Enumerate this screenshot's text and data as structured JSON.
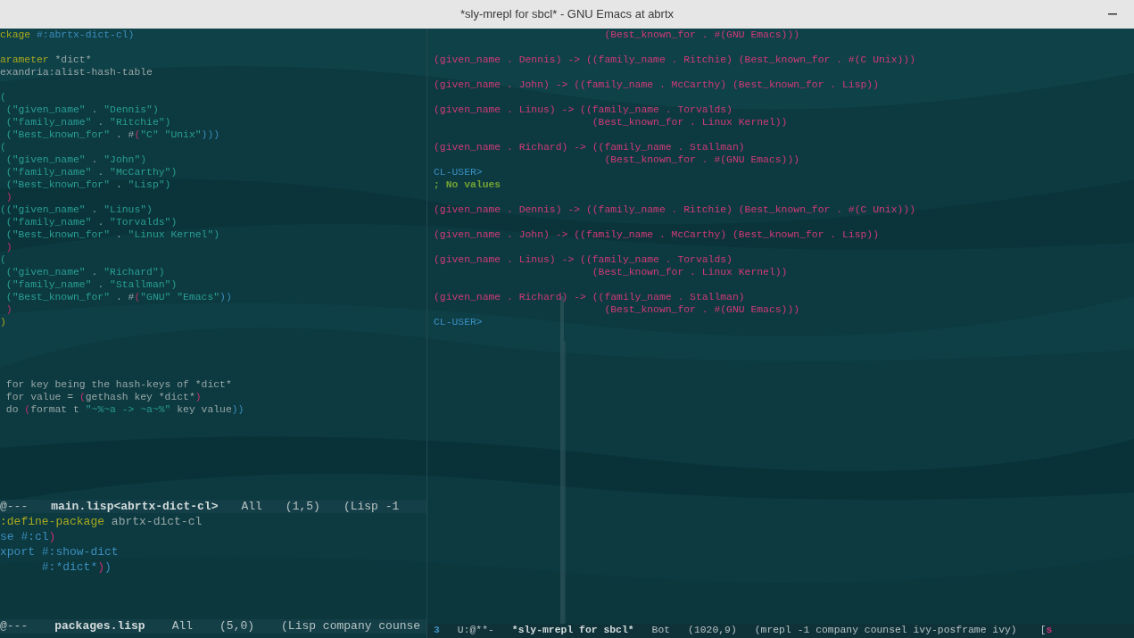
{
  "window": {
    "title": "*sly-mrepl for sbcl* - GNU Emacs at abrtx"
  },
  "left_top_buffer": {
    "lines": [
      {
        "kind": "code",
        "segments": [
          {
            "text": "ckage",
            "kind": "kw"
          },
          {
            "text": " #:abrtx-dict-cl",
            "kind": "sym"
          },
          {
            "text": ")",
            "kind": "pb"
          }
        ]
      },
      {
        "kind": "blank"
      },
      {
        "kind": "code",
        "segments": [
          {
            "text": "arameter",
            "kind": "kw"
          },
          {
            "text": " *dict*",
            "kind": "plain"
          }
        ]
      },
      {
        "kind": "code",
        "segments": [
          {
            "text": "exandria:alist-hash-table",
            "kind": "plain"
          }
        ]
      },
      {
        "kind": "blank"
      },
      {
        "kind": "code",
        "segments": [
          {
            "text": "(",
            "kind": "str"
          }
        ]
      },
      {
        "kind": "code",
        "segments": [
          {
            "text": " (\"given_name\"",
            "kind": "str"
          },
          {
            "text": " . ",
            "kind": "plain"
          },
          {
            "text": "\"Dennis\")",
            "kind": "str"
          }
        ]
      },
      {
        "kind": "code",
        "segments": [
          {
            "text": " (\"family_name\"",
            "kind": "str"
          },
          {
            "text": " . ",
            "kind": "plain"
          },
          {
            "text": "\"Ritchie\")",
            "kind": "str"
          }
        ]
      },
      {
        "kind": "code",
        "segments": [
          {
            "text": " (\"Best_known_for\"",
            "kind": "str"
          },
          {
            "text": " . #",
            "kind": "plain"
          },
          {
            "text": "(",
            "kind": "pm"
          },
          {
            "text": "\"C\" \"Unix\"",
            "kind": "str"
          },
          {
            "text": ")))",
            "kind": "pb"
          }
        ]
      },
      {
        "kind": "code",
        "segments": [
          {
            "text": "(",
            "kind": "str"
          }
        ]
      },
      {
        "kind": "code",
        "segments": [
          {
            "text": " (\"given_name\"",
            "kind": "str"
          },
          {
            "text": " . ",
            "kind": "plain"
          },
          {
            "text": "\"John\")",
            "kind": "str"
          }
        ]
      },
      {
        "kind": "code",
        "segments": [
          {
            "text": " (\"family_name\"",
            "kind": "str"
          },
          {
            "text": " . ",
            "kind": "plain"
          },
          {
            "text": "\"McCarthy\")",
            "kind": "str"
          }
        ]
      },
      {
        "kind": "code",
        "segments": [
          {
            "text": " (\"Best_known_for\"",
            "kind": "str"
          },
          {
            "text": " . ",
            "kind": "plain"
          },
          {
            "text": "\"Lisp\")",
            "kind": "str"
          }
        ]
      },
      {
        "kind": "code",
        "segments": [
          {
            "text": " )",
            "kind": "pm"
          }
        ]
      },
      {
        "kind": "code",
        "segments": [
          {
            "text": "((\"given_name\"",
            "kind": "str"
          },
          {
            "text": " . ",
            "kind": "plain"
          },
          {
            "text": "\"Linus\")",
            "kind": "str"
          }
        ]
      },
      {
        "kind": "code",
        "segments": [
          {
            "text": " (\"family_name\"",
            "kind": "str"
          },
          {
            "text": " . ",
            "kind": "plain"
          },
          {
            "text": "\"Torvalds\")",
            "kind": "str"
          }
        ]
      },
      {
        "kind": "code",
        "segments": [
          {
            "text": " (\"Best_known_for\"",
            "kind": "str"
          },
          {
            "text": " . ",
            "kind": "plain"
          },
          {
            "text": "\"Linux Kernel\")",
            "kind": "str"
          }
        ]
      },
      {
        "kind": "code",
        "segments": [
          {
            "text": " )",
            "kind": "pm"
          }
        ]
      },
      {
        "kind": "code",
        "segments": [
          {
            "text": "(",
            "kind": "str"
          }
        ]
      },
      {
        "kind": "code",
        "segments": [
          {
            "text": " (\"given_name\"",
            "kind": "str"
          },
          {
            "text": " . ",
            "kind": "plain"
          },
          {
            "text": "\"Richard\")",
            "kind": "str"
          }
        ]
      },
      {
        "kind": "code",
        "segments": [
          {
            "text": " (\"family_name\"",
            "kind": "str"
          },
          {
            "text": " . ",
            "kind": "plain"
          },
          {
            "text": "\"Stallman\")",
            "kind": "str"
          }
        ]
      },
      {
        "kind": "code",
        "segments": [
          {
            "text": " (\"Best_known_for\"",
            "kind": "str"
          },
          {
            "text": " . #",
            "kind": "plain"
          },
          {
            "text": "(",
            "kind": "pm"
          },
          {
            "text": "\"GNU\" \"Emacs\"",
            "kind": "str"
          },
          {
            "text": "))",
            "kind": "pb"
          }
        ]
      },
      {
        "kind": "code",
        "segments": [
          {
            "text": " )",
            "kind": "pm"
          }
        ]
      },
      {
        "kind": "code",
        "segments": [
          {
            "text": ")",
            "kind": "kw"
          }
        ]
      },
      {
        "kind": "blank"
      },
      {
        "kind": "blank"
      },
      {
        "kind": "blank"
      },
      {
        "kind": "blank"
      },
      {
        "kind": "code",
        "segments": [
          {
            "text": " for key being the hash-keys of *dict*",
            "kind": "plain"
          }
        ]
      },
      {
        "kind": "code",
        "segments": [
          {
            "text": " for value = ",
            "kind": "plain"
          },
          {
            "text": "(",
            "kind": "pm"
          },
          {
            "text": "gethash key *dict*",
            "kind": "plain"
          },
          {
            "text": ")",
            "kind": "pm"
          }
        ]
      },
      {
        "kind": "code",
        "segments": [
          {
            "text": " do ",
            "kind": "plain"
          },
          {
            "text": "(",
            "kind": "pm"
          },
          {
            "text": "format t ",
            "kind": "plain"
          },
          {
            "text": "\"~%~a -> ~a~%\"",
            "kind": "str"
          },
          {
            "text": " key value",
            "kind": "plain"
          },
          {
            "text": "))",
            "kind": "pb"
          }
        ]
      }
    ]
  },
  "left_top_mode_line": {
    "segments": [
      {
        "text": "@---",
        "kind": "text"
      },
      {
        "text": "main.lisp<abrtx-dict-cl>",
        "kind": "bold"
      },
      {
        "text": "All",
        "kind": "text"
      },
      {
        "text": "(1,5)",
        "kind": "text"
      },
      {
        "text": "(Lisp -1",
        "kind": "text"
      }
    ]
  },
  "left_bottom_buffer": {
    "lines": [
      {
        "kind": "code",
        "segments": [
          {
            "text": ":define-package",
            "kind": "kw"
          },
          {
            "text": " abrtx-dict-cl",
            "kind": "plain"
          }
        ]
      },
      {
        "kind": "code",
        "segments": [
          {
            "text": "se #:cl",
            "kind": "sym"
          },
          {
            "text": ")",
            "kind": "pm"
          }
        ]
      },
      {
        "kind": "code",
        "segments": [
          {
            "text": "xport #:show-dict",
            "kind": "sym"
          }
        ]
      },
      {
        "kind": "code",
        "segments": [
          {
            "text": "      #:*dict*",
            "kind": "sym"
          },
          {
            "text": ")",
            "kind": "pm"
          },
          {
            "text": ")",
            "kind": "pb"
          }
        ]
      }
    ]
  },
  "left_bottom_mode_line": {
    "segments": [
      {
        "text": "@---",
        "kind": "text"
      },
      {
        "text": "packages.lisp",
        "kind": "bold"
      },
      {
        "text": "All",
        "kind": "text"
      },
      {
        "text": "(5,0)",
        "kind": "text"
      },
      {
        "text": "(Lisp company counse",
        "kind": "text"
      }
    ]
  },
  "repl_buffer": {
    "lines": [
      {
        "kind": "code",
        "segments": [
          {
            "text": "                            (Best_known_for . #(GNU Emacs)))",
            "kind": "out"
          }
        ]
      },
      {
        "kind": "blank"
      },
      {
        "kind": "code",
        "segments": [
          {
            "text": "(given_name . Dennis) -> ((family_name . Ritchie) (Best_known_for . #(C Unix)))",
            "kind": "out"
          }
        ]
      },
      {
        "kind": "blank"
      },
      {
        "kind": "code",
        "segments": [
          {
            "text": "(given_name . John) -> ((family_name . McCarthy) (Best_known_for . Lisp))",
            "kind": "out"
          }
        ]
      },
      {
        "kind": "blank"
      },
      {
        "kind": "code",
        "segments": [
          {
            "text": "(given_name . Linus) -> ((family_name . Torvalds)",
            "kind": "out"
          }
        ]
      },
      {
        "kind": "code",
        "segments": [
          {
            "text": "                          (Best_known_for . Linux Kernel))",
            "kind": "out"
          }
        ]
      },
      {
        "kind": "blank"
      },
      {
        "kind": "code",
        "segments": [
          {
            "text": "(given_name . Richard) -> ((family_name . Stallman)",
            "kind": "out"
          }
        ]
      },
      {
        "kind": "code",
        "segments": [
          {
            "text": "                            (Best_known_for . #(GNU Emacs)))",
            "kind": "out"
          }
        ]
      },
      {
        "kind": "code",
        "segments": [
          {
            "text": "CL-USER>",
            "kind": "prompt"
          }
        ]
      },
      {
        "kind": "code",
        "segments": [
          {
            "text": "; No values",
            "kind": "comment"
          }
        ]
      },
      {
        "kind": "blank"
      },
      {
        "kind": "code",
        "segments": [
          {
            "text": "(given_name . Dennis) -> ((family_name . Ritchie) (Best_known_for . #(C Unix)))",
            "kind": "out"
          }
        ]
      },
      {
        "kind": "blank"
      },
      {
        "kind": "code",
        "segments": [
          {
            "text": "(given_name . John) -> ((family_name . McCarthy) (Best_known_for . Lisp))",
            "kind": "out"
          }
        ]
      },
      {
        "kind": "blank"
      },
      {
        "kind": "code",
        "segments": [
          {
            "text": "(given_name . Linus) -> ((family_name . Torvalds)",
            "kind": "out"
          }
        ]
      },
      {
        "kind": "code",
        "segments": [
          {
            "text": "                          (Best_known_for . Linux Kernel))",
            "kind": "out"
          }
        ]
      },
      {
        "kind": "blank"
      },
      {
        "kind": "code",
        "segments": [
          {
            "text": "(given_name . Richard) -> ((family_name . Stallman)",
            "kind": "out"
          }
        ]
      },
      {
        "kind": "code",
        "segments": [
          {
            "text": "                            (Best_known_for . #(GNU Emacs)))",
            "kind": "out"
          }
        ]
      },
      {
        "kind": "code",
        "segments": [
          {
            "text": "CL-USER>",
            "kind": "prompt"
          }
        ]
      }
    ]
  },
  "repl_mode_line": {
    "segments": [
      {
        "text": "3",
        "kind": "window_number"
      },
      {
        "text": "U:@**-",
        "kind": "text"
      },
      {
        "text": "*sly-mrepl for sbcl*",
        "kind": "bold"
      },
      {
        "text": "Bot",
        "kind": "text"
      },
      {
        "text": "(1020,9)",
        "kind": "text"
      },
      {
        "text": "(mrepl -1 company counsel ivy-posframe ivy)",
        "kind": "text"
      },
      {
        "text": "[",
        "kind": "bracket"
      },
      {
        "text": "s",
        "kind": "flag"
      }
    ]
  }
}
